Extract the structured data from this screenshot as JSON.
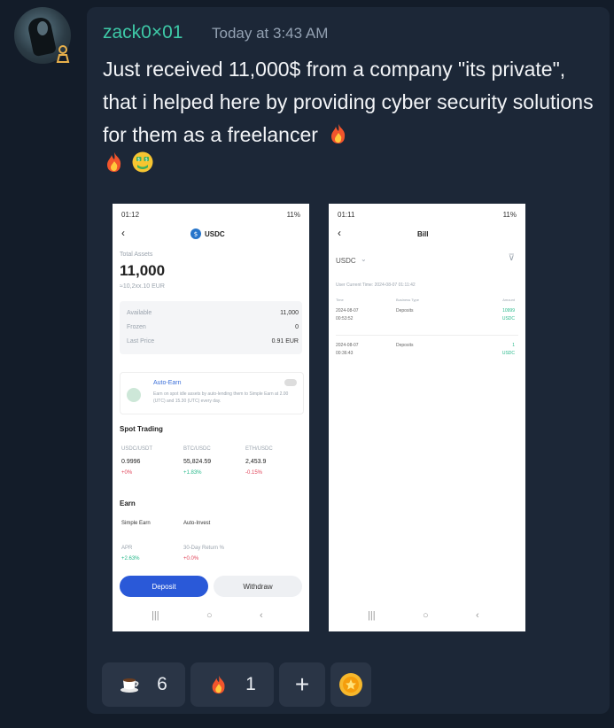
{
  "message": {
    "username": "zack0×01",
    "timestamp": "Today at 3:43 AM",
    "text": "Just received 11,000$ from a company \"its private\", that i helped here by providing cyber security solutions for them as a freelancer",
    "trailing_emojis": [
      "fire",
      "fire",
      "money-mouth-face"
    ]
  },
  "screenshot1": {
    "status_time": "01:12",
    "status_right": "11%",
    "coin": "USDC",
    "total_assets_label": "Total Assets",
    "total": "11,000",
    "total_sub": "≈10,2xx.10 EUR",
    "rows": [
      {
        "label": "Available",
        "value": "11,000"
      },
      {
        "label": "Frozen",
        "value": "0"
      },
      {
        "label": "Last Price",
        "value": "0.91 EUR"
      }
    ],
    "auto_earn_title": "Auto-Earn",
    "auto_earn_desc": "Earn on spot idle assets by auto-lending them to Simple Earn at 2.00 (UTC) and 15.30 (UTC) every day.",
    "spot_trading": "Spot Trading",
    "pairs": [
      {
        "pair": "USDC/USDT",
        "price": "0.9996",
        "change": "+0%"
      },
      {
        "pair": "BTC/USDC",
        "price": "55,824.59",
        "change": "+1.83%"
      },
      {
        "pair": "ETH/USDC",
        "price": "2,453.9",
        "change": "-0.15%"
      }
    ],
    "earn": "Earn",
    "earn_items": [
      {
        "name": "Simple Earn",
        "label": "APR",
        "value": "+2.63%"
      },
      {
        "name": "Auto-Invest",
        "label": "30-Day Return %",
        "value": "+0.0%"
      }
    ],
    "deposit": "Deposit",
    "withdraw": "Withdraw"
  },
  "screenshot2": {
    "status_time": "01:11",
    "status_right": "11%",
    "title": "Bill",
    "filter": "USDC",
    "user_time": "User Current Time: 2024-08-07 01:11:42",
    "col_time": "Time",
    "col_type": "Business Type",
    "col_amount": "Amount",
    "entries": [
      {
        "date": "2024-08-07",
        "time": "00:53:52",
        "type": "Deposits",
        "amount": "10999",
        "coin": "USDC"
      },
      {
        "date": "2024-08-07",
        "time": "00:36:43",
        "type": "Deposits",
        "amount": "1",
        "coin": "USDC"
      }
    ]
  },
  "reactions": [
    {
      "icon": "coffee",
      "count": "6"
    },
    {
      "icon": "fire",
      "count": "1"
    }
  ],
  "add_reaction_label": "+"
}
